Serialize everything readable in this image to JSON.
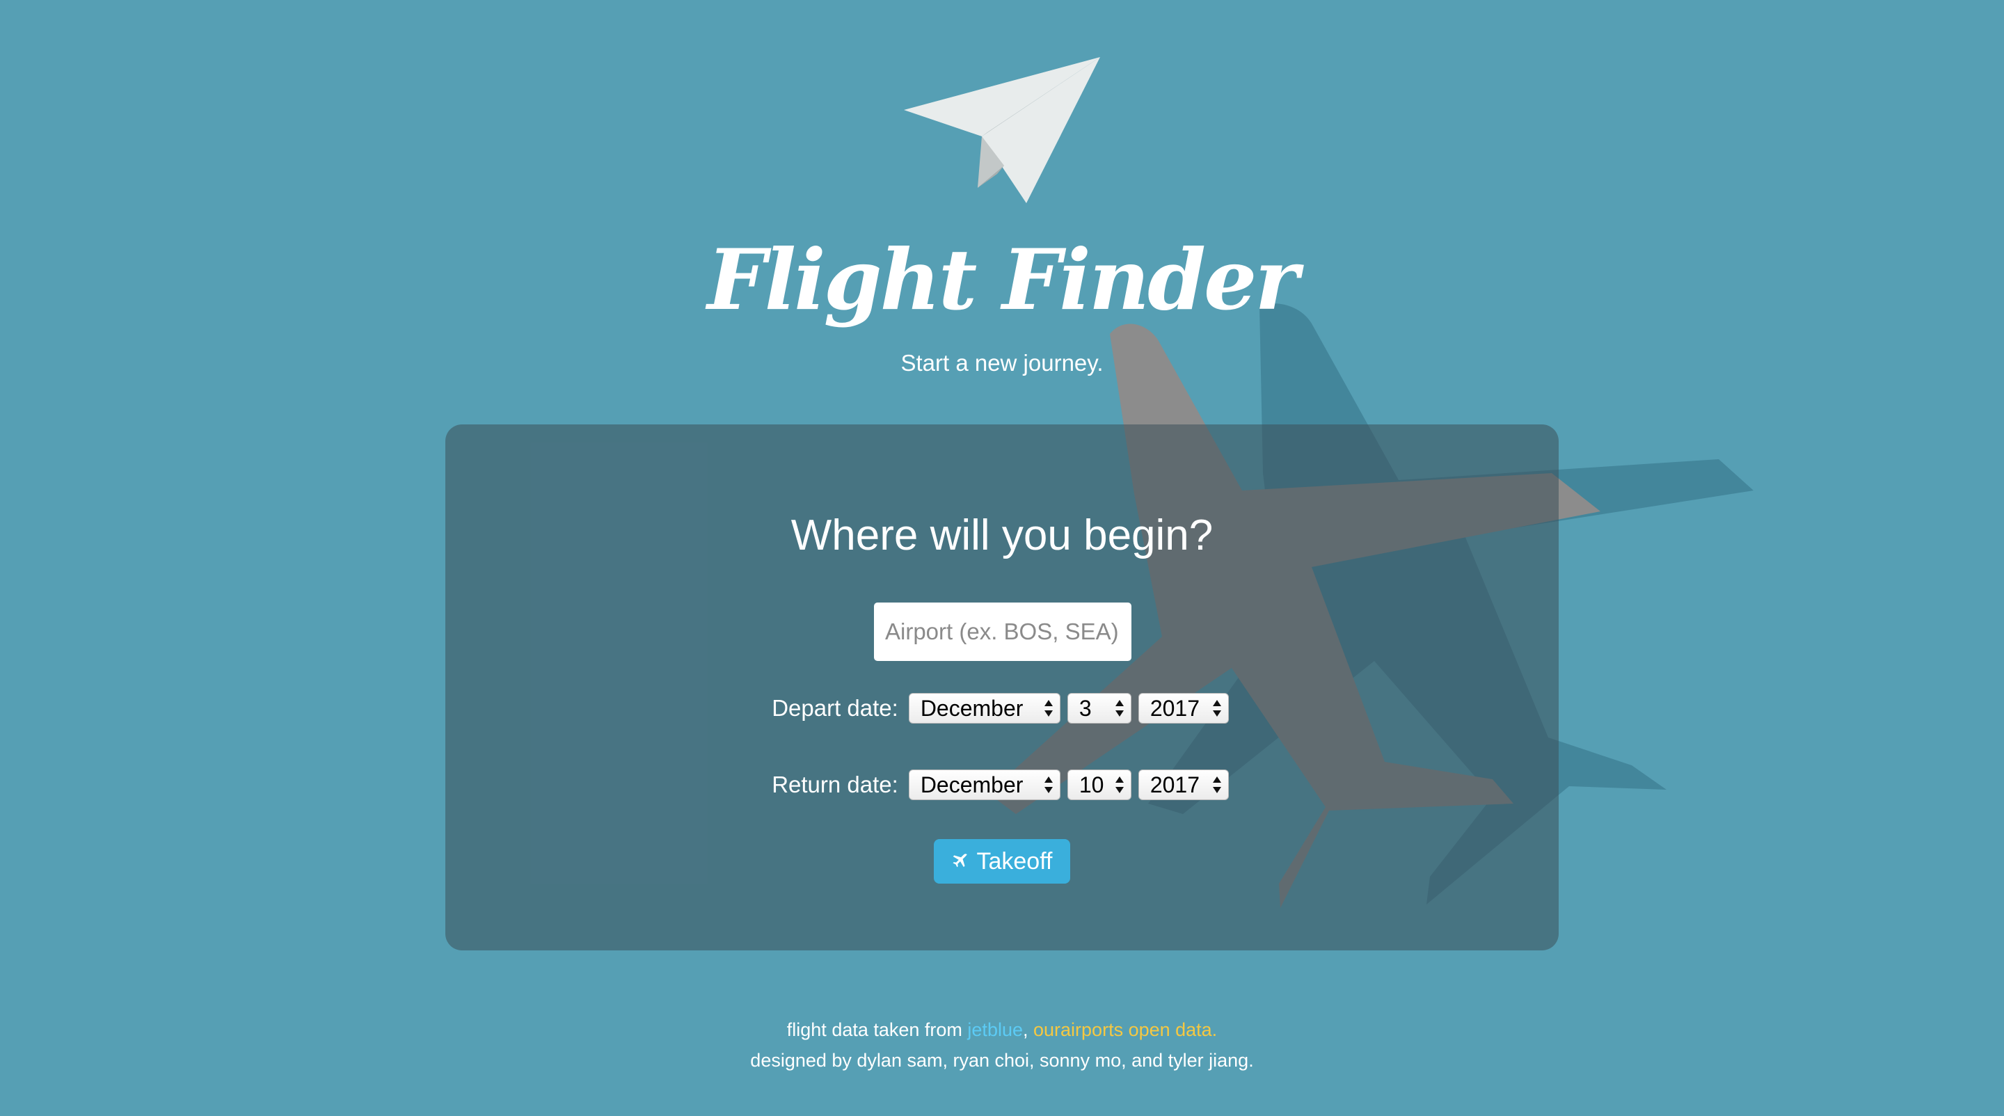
{
  "app": {
    "title": "Flight Finder",
    "subtitle": "Start a new journey."
  },
  "panel": {
    "heading": "Where will you begin?",
    "airport_placeholder": "Airport (ex. BOS, SEA)",
    "depart": {
      "label": "Depart date:",
      "month": "December",
      "day": "3",
      "year": "2017"
    },
    "return": {
      "label": "Return date:",
      "month": "December",
      "day": "10",
      "year": "2017"
    },
    "button_label": "Takeoff"
  },
  "footer": {
    "credit_prefix": "flight data taken from ",
    "link_jetblue": "jetblue",
    "separator": ", ",
    "link_ourairports": "ourairports open data.",
    "designers": "designed by dylan sam, ryan choi, sonny mo, and tyler jiang."
  },
  "colors": {
    "background": "#569fb4",
    "panel": "rgba(60,80,90,0.55)",
    "button": "#3aafdc",
    "jetblue_link": "#5ccbf5",
    "ourairports_link": "#f5c842"
  },
  "icons": {
    "logo": "paper-plane-icon",
    "button": "plane-icon",
    "select_arrows": "up-down-arrows-icon"
  }
}
